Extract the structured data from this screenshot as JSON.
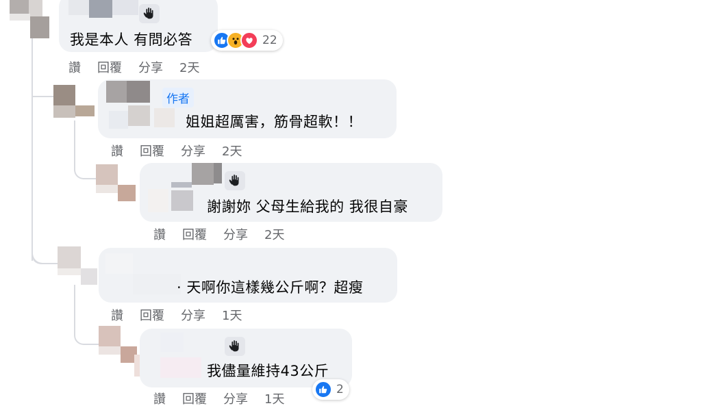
{
  "comments": [
    {
      "text": "我是本人 有問必答",
      "actions": {
        "like": "讚",
        "reply": "回覆",
        "share": "分享",
        "time": "2天"
      },
      "reactions": {
        "count": "22",
        "types": [
          "like-icon",
          "wow-icon",
          "love-icon"
        ]
      }
    },
    {
      "badge": "作者",
      "text": "姐姐超厲害，筋骨超軟！！",
      "actions": {
        "like": "讚",
        "reply": "回覆",
        "share": "分享",
        "time": "2天"
      }
    },
    {
      "text": "謝謝妳 父母生給我的 我很自豪",
      "actions": {
        "like": "讚",
        "reply": "回覆",
        "share": "分享",
        "time": "2天"
      }
    },
    {
      "text": "· 天啊你這樣幾公斤啊？超瘦",
      "actions": {
        "like": "讚",
        "reply": "回覆",
        "share": "分享",
        "time": "1天"
      }
    },
    {
      "text": "我儘量維持43公斤",
      "actions": {
        "like": "讚",
        "reply": "回覆",
        "share": "分享",
        "time": "1天"
      },
      "reactions": {
        "count": "2",
        "types": [
          "like-icon"
        ]
      }
    }
  ],
  "colors": {
    "bubble": "#f0f2f5",
    "meta": "#65676b",
    "like": "#1877f2",
    "love": "#f33e58",
    "wow": "#f7b125",
    "author_badge_bg": "#e7f0fd"
  },
  "icons": {
    "wave": "waving-hand-icon"
  }
}
